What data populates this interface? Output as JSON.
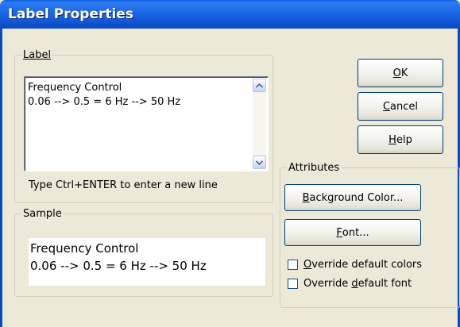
{
  "window": {
    "title": "Label Properties"
  },
  "label_group": {
    "legend": "Label",
    "text_lines": [
      "Frequency Control",
      "0.06 --> 0.5 = 6 Hz --> 50 Hz"
    ],
    "hint": "Type Ctrl+ENTER to enter a new line"
  },
  "sample_group": {
    "legend": "Sample",
    "text_lines": [
      "Frequency Control",
      "0.06 --> 0.5 = 6 Hz --> 50 Hz"
    ]
  },
  "buttons": {
    "ok": {
      "mnemonic": "O",
      "rest": "K"
    },
    "cancel": {
      "mnemonic": "C",
      "rest": "ancel"
    },
    "help": {
      "mnemonic": "H",
      "rest": "elp"
    }
  },
  "attributes": {
    "legend": "Attributes",
    "background_color": {
      "mnemonic": "B",
      "rest": "ackground Color..."
    },
    "font": {
      "mnemonic": "F",
      "rest": "ont..."
    },
    "override_colors": {
      "pre": "",
      "mnemonic": "O",
      "post": "verride default colors",
      "checked": false
    },
    "override_font": {
      "pre": "Override ",
      "mnemonic": "d",
      "post": "efault font",
      "checked": false
    }
  },
  "colors": {
    "title_bar": "#1257D6",
    "dialog_bg": "#ECE9D8",
    "button_border": "#003C74"
  },
  "icons": {
    "scroll_up": "chevron-up-icon",
    "scroll_down": "chevron-down-icon"
  }
}
